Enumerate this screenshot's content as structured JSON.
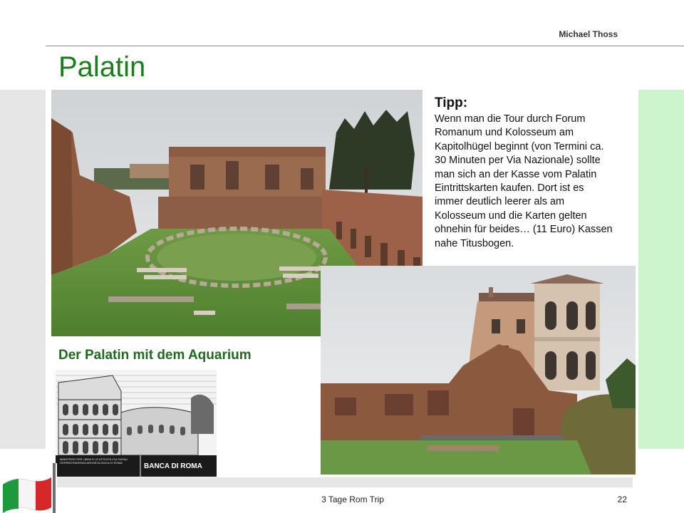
{
  "header": {
    "author": "Michael Thoss",
    "title": "Palatin"
  },
  "tip": {
    "heading": "Tipp:",
    "text": "Wenn man die Tour durch Forum Romanum und Kolosseum am Kapitolhügel beginnt (von Termini ca. 30 Minuten per Via Nazionale) sollte man sich an der Kasse vom Palatin Eintrittskarten kaufen. Dort ist es immer deutlich leerer als am Kolosseum und die Karten gelten ohnehin für beides… (11 Euro) Kassen nahe Titusbogen."
  },
  "caption": "Der Palatin mit dem Aquarium",
  "ticket": {
    "text_left": "MINISTERO PER I BENI E LE ATTIVITÀ CULTURALI SOPRINTENDENZA ARCHEOLOGICA DI ROMA",
    "brand": "BANCA DI ROMA"
  },
  "footer": {
    "text": "3 Tage Rom Trip",
    "page_number": "22"
  },
  "colors": {
    "title": "#17801a",
    "caption": "#1e6b1e",
    "band_left": "#e6e6e6",
    "band_right": "#ccf5cc"
  },
  "icons": {
    "flag": "italian-flag-icon"
  }
}
